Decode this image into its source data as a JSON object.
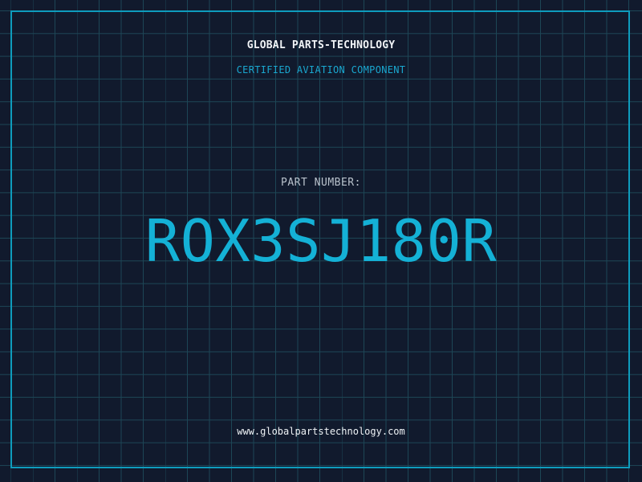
{
  "header": {
    "company": "GLOBAL PARTS-TECHNOLOGY",
    "subtitle": "CERTIFIED AVIATION COMPONENT"
  },
  "part": {
    "label": "PART NUMBER:",
    "number": "ROX3SJ180R"
  },
  "footer": {
    "website": "www.globalpartstechnology.com"
  },
  "colors": {
    "background": "#111a2d",
    "grid": "#1d4656",
    "accent": "#14b1d6",
    "frame": "#0e9cbd",
    "text": "#f0f3f6"
  }
}
